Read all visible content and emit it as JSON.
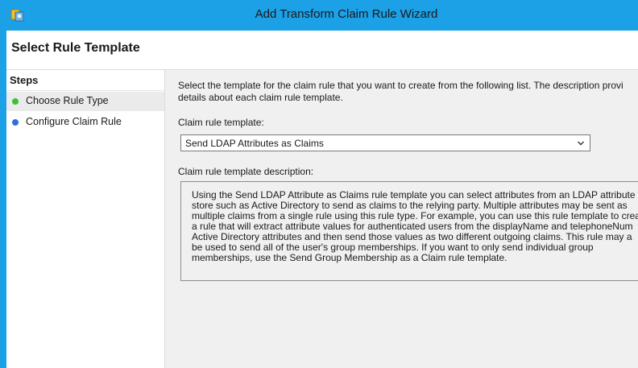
{
  "window": {
    "title": "Add Transform Claim Rule Wizard"
  },
  "header": {
    "title": "Select Rule Template"
  },
  "steps": {
    "heading": "Steps",
    "items": [
      {
        "label": "Choose Rule Type",
        "status": "current",
        "color": "#3fbf3f"
      },
      {
        "label": "Configure Claim Rule",
        "status": "pending",
        "color": "#2f6fe0"
      }
    ]
  },
  "main": {
    "instructions": [
      "Select the template for the claim rule that you want to create from the following list. The description provi",
      "details about each claim rule template."
    ],
    "template_label": "Claim rule template:",
    "template_value": "Send LDAP Attributes as Claims",
    "description_label": "Claim rule template description:",
    "description_lines": [
      "Using the Send LDAP Attribute as Claims rule template you can select attributes from an LDAP attribute",
      "store such as Active Directory to send as claims to the relying party. Multiple attributes may be sent as",
      "multiple claims from a single rule using this rule type. For example, you can use this rule template to crea",
      "a rule that will extract attribute values for authenticated users from the displayName and telephoneNum",
      "Active Directory attributes and then send those values as two different outgoing claims. This rule may a",
      "be used to send all of the user's group memberships. If you want to only send individual group",
      "memberships, use the Send Group Membership as a Claim rule template."
    ]
  },
  "colors": {
    "titlebar": "#1ca0e6",
    "step_current": "#3fbf3f",
    "step_pending": "#2f6fe0"
  },
  "icons": {
    "app": "adfs-app-icon",
    "dropdown": "chevron-down-icon"
  }
}
